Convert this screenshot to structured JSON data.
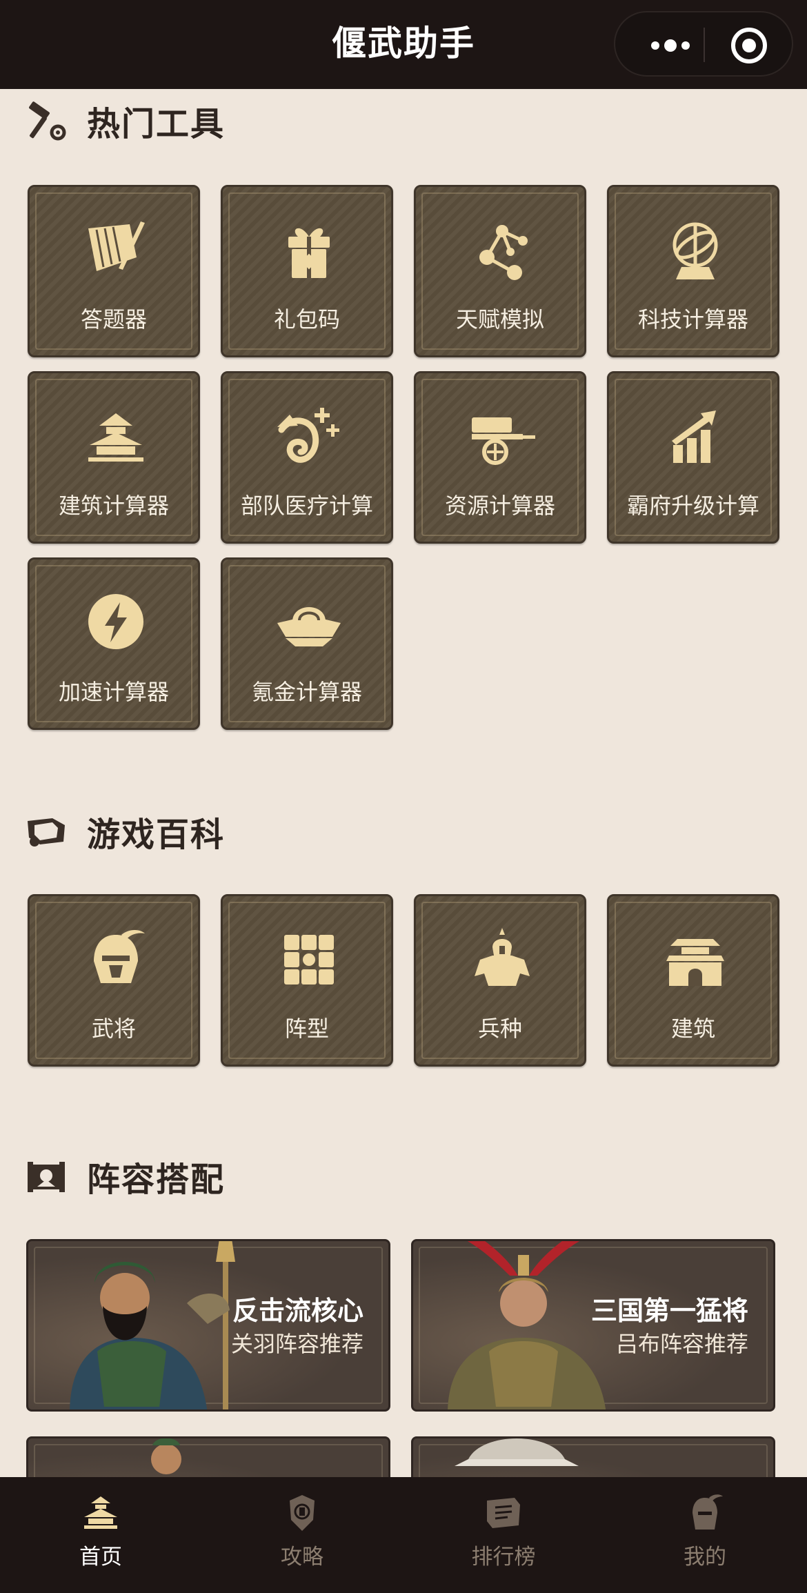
{
  "app_title": "偃武助手",
  "sections": {
    "hot_tools": {
      "title": "热门工具",
      "icon": "hammer-gear-icon",
      "items": [
        {
          "label": "答题器",
          "icon": "bamboo-scroll-brush-icon"
        },
        {
          "label": "礼包码",
          "icon": "gift-box-icon"
        },
        {
          "label": "天赋模拟",
          "icon": "talent-tree-icon"
        },
        {
          "label": "科技计算器",
          "icon": "armillary-sphere-icon"
        },
        {
          "label": "建筑计算器",
          "icon": "palace-icon"
        },
        {
          "label": "部队医疗计算",
          "icon": "healing-swirl-icon"
        },
        {
          "label": "资源计算器",
          "icon": "cart-icon"
        },
        {
          "label": "霸府升级计算",
          "icon": "growth-chart-icon"
        },
        {
          "label": "加速计算器",
          "icon": "lightning-icon"
        },
        {
          "label": "氪金计算器",
          "icon": "gold-ingot-icon"
        }
      ]
    },
    "encyclopedia": {
      "title": "游戏百科",
      "icon": "scroll-icon",
      "items": [
        {
          "label": "武将",
          "icon": "general-helmet-icon"
        },
        {
          "label": "阵型",
          "icon": "formation-grid-icon"
        },
        {
          "label": "兵种",
          "icon": "soldier-icon"
        },
        {
          "label": "建筑",
          "icon": "city-gate-icon"
        }
      ]
    },
    "lineups": {
      "title": "阵容搭配",
      "icon": "war-banner-icon",
      "items": [
        {
          "title": "反击流核心",
          "subtitle": "关羽阵容推荐",
          "image": "guan-yu-portrait"
        },
        {
          "title": "三国第一猛将",
          "subtitle": "吕布阵容推荐",
          "image": "lu-bu-portrait"
        }
      ]
    }
  },
  "tabbar": {
    "items": [
      {
        "label": "首页",
        "icon": "home-palace-icon",
        "active": true
      },
      {
        "label": "攻略",
        "icon": "guide-shield-icon",
        "active": false
      },
      {
        "label": "排行榜",
        "icon": "ranking-scroll-icon",
        "active": false
      },
      {
        "label": "我的",
        "icon": "profile-helmet-icon",
        "active": false
      }
    ]
  },
  "colors": {
    "background": "#efe6dc",
    "top_bar": "#1d1514",
    "tile": "#5b4e3c",
    "icon_gold": "#efd9a4",
    "tab_inactive": "#8c7e70",
    "tab_active": "#ffffff"
  }
}
